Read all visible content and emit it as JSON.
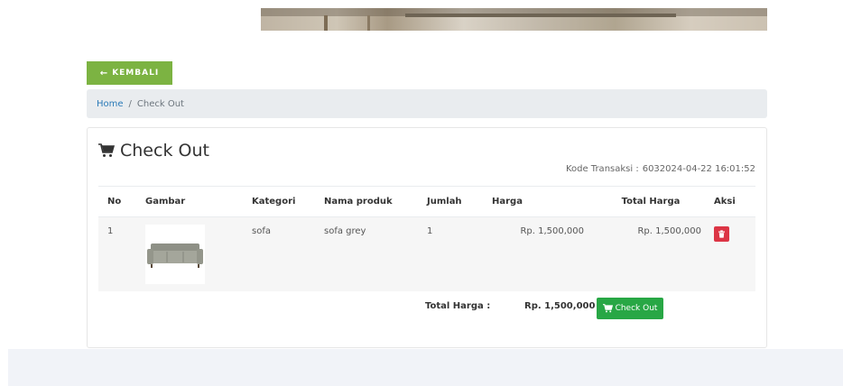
{
  "back_button": {
    "label": "KEMBALI"
  },
  "breadcrumb": {
    "home": "Home",
    "separator": "/",
    "current": "Check Out"
  },
  "card": {
    "title": "Check Out",
    "kode_transaksi_label": "Kode Transaksi :",
    "kode_transaksi_value": "6032024-04-22 16:01:52"
  },
  "table": {
    "headers": [
      "No",
      "Gambar",
      "Kategori",
      "Nama produk",
      "Jumlah",
      "Harga",
      "Total Harga",
      "Aksi"
    ],
    "rows": [
      {
        "no": "1",
        "image_icon": "sofa-image",
        "kategori": "sofa",
        "nama_produk": "sofa grey",
        "jumlah": "1",
        "harga": "Rp. 1,500,000",
        "total_harga": "Rp. 1,500,000"
      }
    ]
  },
  "summary": {
    "total_label": "Total Harga :",
    "total_value": "Rp. 1,500,000",
    "checkout_button": "Check Out"
  },
  "colors": {
    "back_button": "#7cb342",
    "checkout_button": "#28a745",
    "delete_button": "#dc3545",
    "breadcrumb_bg": "#e9ecef",
    "link": "#2a7ab8"
  }
}
